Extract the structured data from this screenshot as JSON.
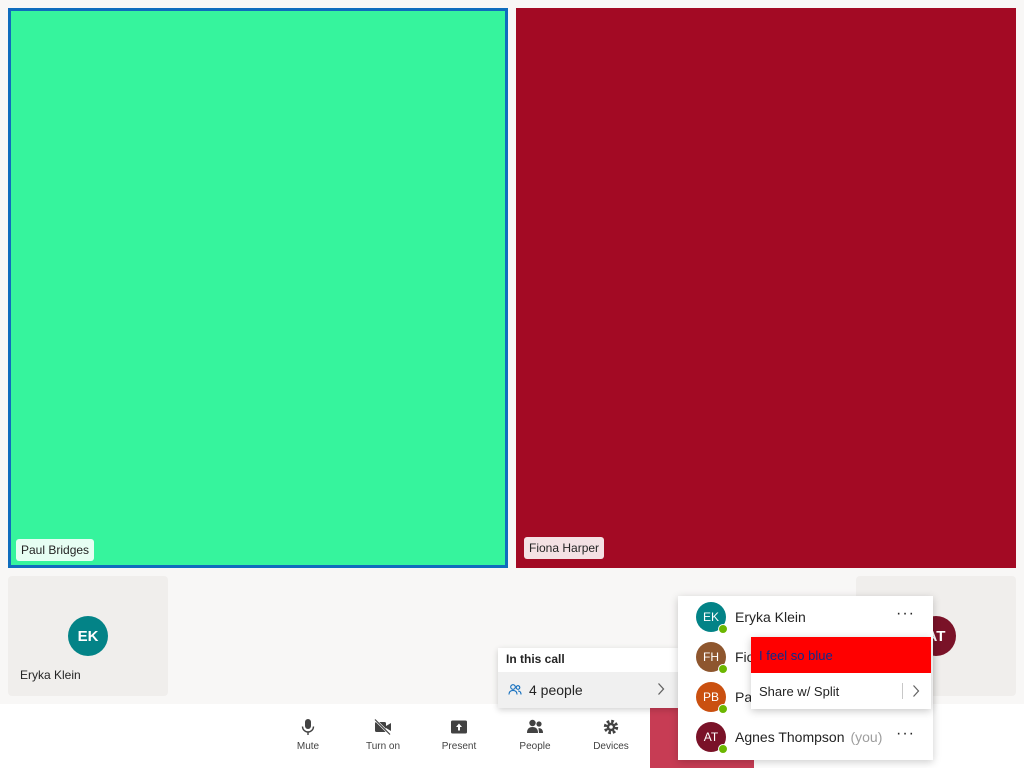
{
  "stage": {
    "tiles": [
      {
        "name": "Paul Bridges",
        "color": "#36f49d",
        "highlight": "#0f6cbd"
      },
      {
        "name": "Fiona Harper",
        "color": "#a30a24"
      }
    ]
  },
  "gallery": {
    "left": {
      "initials": "EK",
      "name": "Eryka Klein",
      "color": "#038387"
    },
    "right": {
      "initials": "AT",
      "color": "#7a1228"
    }
  },
  "toolbar": {
    "mute": "Mute",
    "camera": "Turn on",
    "present": "Present",
    "people": "People",
    "devices": "Devices",
    "leave_color": "#c4314b"
  },
  "in_call": {
    "header": "In this call",
    "count": "4 people"
  },
  "participants": [
    {
      "initials": "EK",
      "name": "Eryka Klein",
      "color": "#038387"
    },
    {
      "initials": "FH",
      "name": "Fiona Harper",
      "color": "#8e562e"
    },
    {
      "initials": "PB",
      "name": "Paul Bridges",
      "color": "#ca5010"
    },
    {
      "initials": "AT",
      "name": "Agnes Thompson",
      "suffix": "(you)",
      "color": "#7a1228"
    }
  ],
  "context_menu": {
    "item1": "I feel so blue",
    "item2": "Share w/ Split"
  },
  "status_color": "#6bb700"
}
